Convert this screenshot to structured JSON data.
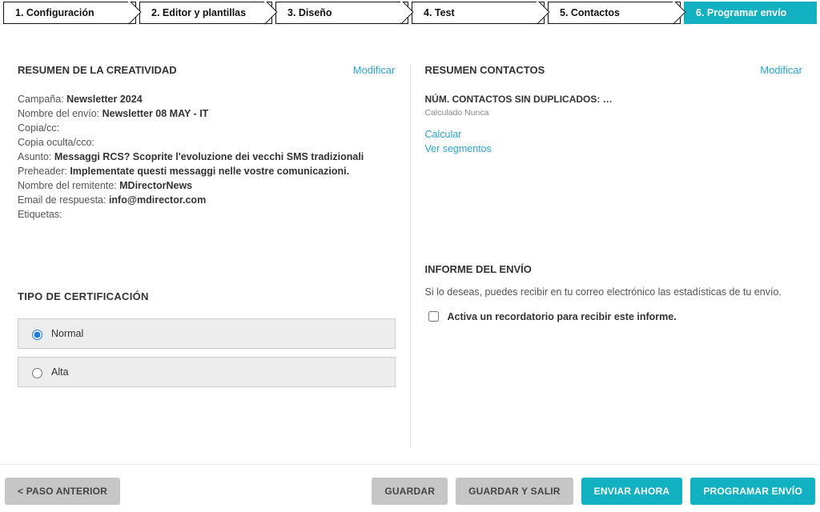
{
  "steps": {
    "s1": "1. Configuración",
    "s2": "2. Editor y plantillas",
    "s3": "3. Diseño",
    "s4": "4. Test",
    "s5": "5. Contactos",
    "s6": "6. Programar envío"
  },
  "creative": {
    "title": "RESUMEN DE LA CREATIVIDAD",
    "modify": "Modificar",
    "campaign_label": "Campaña: ",
    "campaign_value": "Newsletter 2024",
    "send_name_label": "Nombre del envío: ",
    "send_name_value": "Newsletter 08 MAY - IT",
    "cc_label": "Copia/cc:",
    "bcc_label": "Copia oculta/cco:",
    "subject_label": "Asunto: ",
    "subject_value": "Messaggi RCS? Scoprite l'evoluzione dei vecchi SMS tradizionali",
    "preheader_label": "Preheader: ",
    "preheader_value": "Implementate questi messaggi nelle vostre comunicazioni.",
    "sender_label": "Nombre del remitente: ",
    "sender_value": "MDirectorNews",
    "reply_label": "Email de respuesta: ",
    "reply_value": "info@mdirector.com",
    "tags_label": "Etiquetas:"
  },
  "cert": {
    "title": "TIPO DE CERTIFICACIÓN",
    "normal": "Normal",
    "alta": "Alta"
  },
  "contacts": {
    "title": "RESUMEN CONTACTOS",
    "modify": "Modificar",
    "num_label": "NÚM. CONTACTOS SIN DUPLICADOS: …",
    "calculated": "Calculado Nunca",
    "calc_link": "Calcular",
    "segments_link": "Ver segmentos"
  },
  "report": {
    "title": "INFORME DEL ENVÍO",
    "desc": "Si lo deseas, puedes recibir en tu correo electrónico las estadísticas de tu envío.",
    "checkbox_label": "Activa un recordatorio para recibir este informe."
  },
  "footer": {
    "prev": "< PASO ANTERIOR",
    "save": "GUARDAR",
    "save_exit": "GUARDAR Y SALIR",
    "send_now": "ENVIAR AHORA",
    "schedule": "PROGRAMAR ENVÍO"
  }
}
